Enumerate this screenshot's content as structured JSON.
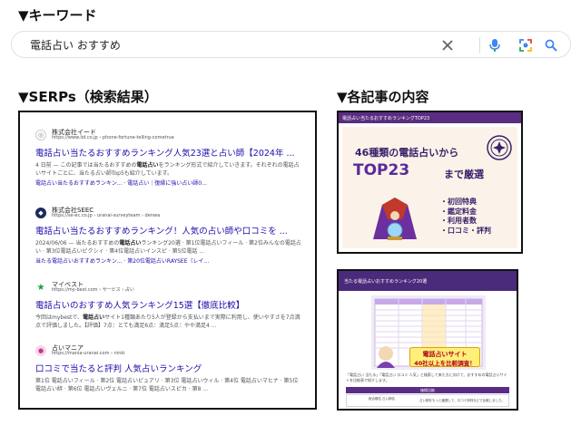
{
  "headings": {
    "keyword": "▼キーワード",
    "serps": "▼SERPs（検索結果）",
    "articles": "▼各記事の内容"
  },
  "search": {
    "query": "電話占い おすすめ",
    "icons": [
      "close-icon",
      "mic-icon",
      "lens-icon",
      "search-icon"
    ]
  },
  "serp_results": [
    {
      "site_name": "株式会社イード",
      "url": "https://www.iid.co.jp › phone-fortune-telling-cometrue",
      "title": "電話占い当たるおすすめランキング人気23選と占い師【2024年 ...",
      "snippet_pre": "4 日前 — この記事では当たるおすすめの",
      "snippet_bold": "電話占い",
      "snippet_post": "をランキング形式で紹介していきます。それぞれの電話占いサイトごとに、当たる占い師Top5も紹介しています。",
      "links": "電話占い当たるおすすめランキン... · 電話占い｜復縁に強い占い師0..."
    },
    {
      "site_name": "株式会社SEEC",
      "url": "https://se-ec.co.jp › uranai-surveyteam › denwa",
      "title": "電話占い当たるおすすめランキング！人気の占い師や口コミを ...",
      "snippet_pre": "2024/06/06 — 当たるおすすめの",
      "snippet_bold": "電話占い",
      "snippet_post": "ランキング20選 · 第1位電話占いフィール · 第2位みんなの電話占い · 第3位電話占いピクシィ · 第4位電話占いインスピ · 第5位電話 ...",
      "links": "当たる電話占いおすすめランキン... · 第20位電話占いRAYSEE（レイ..."
    },
    {
      "site_name": "マイベスト",
      "url": "https://my-best.com › サービス › 占い",
      "title": "電話占いのおすすめ人気ランキング15選【徹底比較】",
      "snippet_pre": "今回はmybestで、",
      "snippet_bold": "電話占い",
      "snippet_post": "サイト1種類あたり5人が登録から支払いまで実際に利用し、使いやすさを7点満点で評価しました。【評価】7点：とても満足6点：満足5点：やや満足4 ...",
      "links": ""
    },
    {
      "site_name": "占いマニア",
      "url": "https://mania-uranai.com › ninki",
      "title": "口コミで当たると評判 人気占いランキング",
      "snippet_pre": "第1位 電話占いフィール · 第2位 電話占いピュアリ · 第3位 電話占いウィル · 第4位 電話占いマヒナ · 第5位 電話占い絆 · 第6位 電話占いヴェルニ · 第7位 電話占いスピカ · 第8 ...",
      "snippet_bold": "",
      "snippet_post": "",
      "links": ""
    }
  ],
  "article1": {
    "header": "電話占い当たるおすすめランキングTOP23",
    "line1": "46種類の電話占いから",
    "big": "TOP23",
    "small": "まで厳選",
    "bullets": [
      "・初回特典",
      "・鑑定料金",
      "・利用者数",
      "・口コミ・評判"
    ]
  },
  "article2": {
    "header": "当たる電話占いおすすめランキング20選",
    "badge_line1": "電話占いサイト",
    "badge_line2": "40社以上を比較調査！",
    "text": "「電話占い 当たる」「電話占い 口コミ 人気」と検索して来た方に向けて、おすすめの電話占いサイトを比較表で紹介します。",
    "bar": "価格比較",
    "row_left": "総合順位\n占い師名",
    "row_right": "占い師をもっと厳選して、口コミ評判などで比較しました。"
  },
  "colors": {
    "link_blue": "#1a0dab",
    "purple": "#5a2d82"
  }
}
